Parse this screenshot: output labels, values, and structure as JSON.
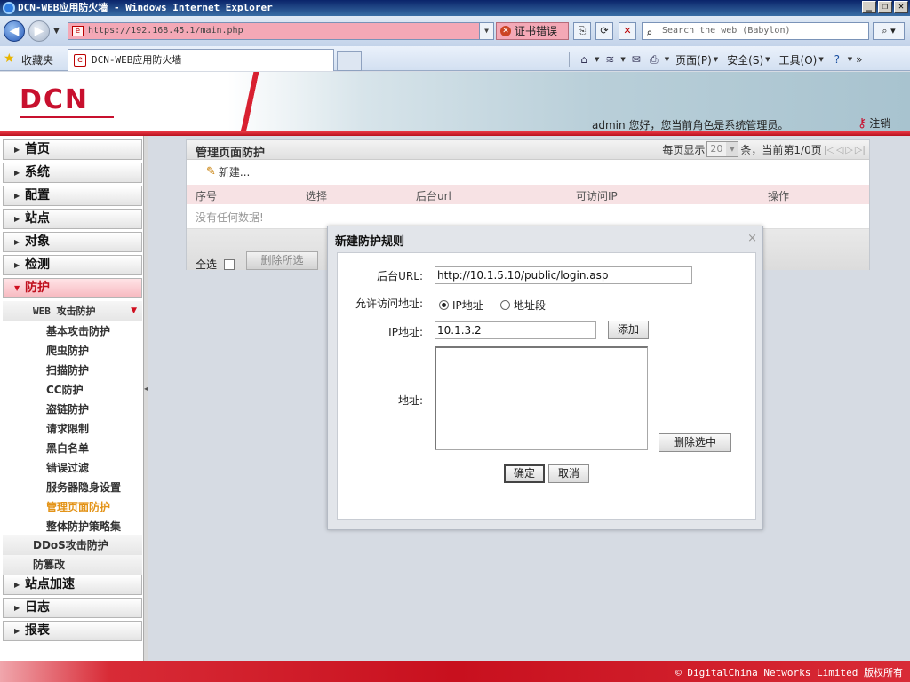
{
  "window": {
    "title": "DCN-WEB应用防火墙 - Windows Internet Explorer",
    "min": "_",
    "max": "❐",
    "close": "✕"
  },
  "addressbar": {
    "url": "https://192.168.45.1/main.php",
    "cert_error": "证书错误",
    "search_placeholder": "Search the web (Babylon)"
  },
  "favbar": {
    "favorites": "收藏夹",
    "tab_title": "DCN-WEB应用防火墙",
    "commands": [
      {
        "label": "页面(P)"
      },
      {
        "label": "安全(S)"
      },
      {
        "label": "工具(O)"
      }
    ],
    "more": "»"
  },
  "header": {
    "logo": "DCN",
    "welcome": "admin 您好，您当前角色是系统管理员。",
    "logout": "注销"
  },
  "sidebar": {
    "items": [
      {
        "label": "首页"
      },
      {
        "label": "系统"
      },
      {
        "label": "配置"
      },
      {
        "label": "站点"
      },
      {
        "label": "对象"
      },
      {
        "label": "检测"
      },
      {
        "label": "防护"
      }
    ],
    "group": "WEB 攻击防护",
    "sub_items": [
      {
        "label": "基本攻击防护"
      },
      {
        "label": "爬虫防护"
      },
      {
        "label": "扫描防护"
      },
      {
        "label": "CC防护"
      },
      {
        "label": "盗链防护"
      },
      {
        "label": "请求限制"
      },
      {
        "label": "黑白名单"
      },
      {
        "label": "错误过滤"
      },
      {
        "label": "服务器隐身设置"
      },
      {
        "label": "管理页面防护"
      },
      {
        "label": "整体防护策略集"
      }
    ],
    "group2": "DDoS攻击防护",
    "group3": "防篡改",
    "bottom_items": [
      {
        "label": "站点加速"
      },
      {
        "label": "日志"
      },
      {
        "label": "报表"
      }
    ]
  },
  "panel": {
    "title": "管理页面防护",
    "pager": {
      "per_page_label": "每页显示",
      "per_page": "20",
      "status": "条，当前第1/0页"
    },
    "new_label": "新建...",
    "columns": [
      "序号",
      "选择",
      "后台url",
      "可访问IP",
      "操作"
    ],
    "empty": "没有任何数据!",
    "select_all": "全选",
    "delete_selected": "删除所选"
  },
  "dialog": {
    "title": "新建防护规则",
    "close": "×",
    "url_label": "后台URL:",
    "url_value": "http://10.1.5.10/public/login.asp",
    "allow_label": "允许访问地址:",
    "radio_ip": "IP地址",
    "radio_range": "地址段",
    "ip_label": "IP地址:",
    "ip_value": "10.1.3.2",
    "add": "添加",
    "addr_label": "地址:",
    "delete_selected": "删除选中",
    "ok": "确定",
    "cancel": "取消"
  },
  "footer": {
    "copyright": "© DigitalChina Networks Limited 版权所有"
  }
}
